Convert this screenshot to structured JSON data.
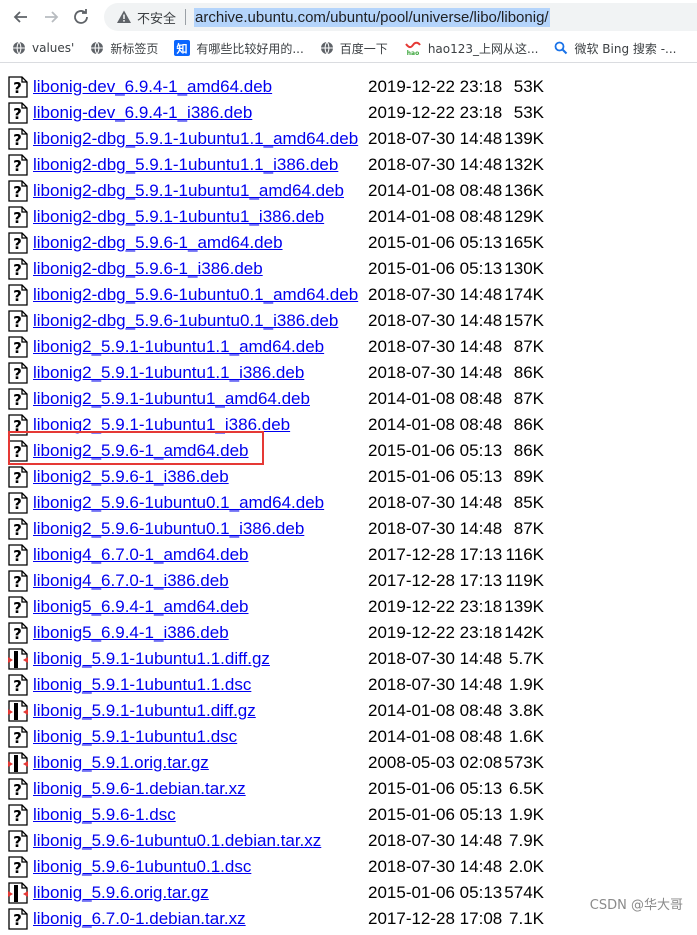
{
  "browser": {
    "security_label": "不安全",
    "url": "archive.ubuntu.com/ubuntu/pool/universe/libo/libonig/"
  },
  "bookmarks": [
    {
      "label": "values'",
      "icon": "globe-icon"
    },
    {
      "label": "新标签页",
      "icon": "globe-icon"
    },
    {
      "label": "有哪些比较好用的...",
      "icon": "zhihu-icon"
    },
    {
      "label": "百度一下",
      "icon": "globe-icon"
    },
    {
      "label": "hao123_上网从这...",
      "icon": "hao123-icon"
    },
    {
      "label": "微软 Bing 搜索 -...",
      "icon": "search-icon"
    }
  ],
  "files": [
    {
      "name": "libonig-dev_6.9.4-1_amd64.deb",
      "date": "2019-12-22 23:18",
      "size": "53K",
      "icon": "unknown-file-icon"
    },
    {
      "name": "libonig-dev_6.9.4-1_i386.deb",
      "date": "2019-12-22 23:18",
      "size": "53K",
      "icon": "unknown-file-icon"
    },
    {
      "name": "libonig2-dbg_5.9.1-1ubuntu1.1_amd64.deb",
      "date": "2018-07-30 14:48",
      "size": "139K",
      "icon": "unknown-file-icon"
    },
    {
      "name": "libonig2-dbg_5.9.1-1ubuntu1.1_i386.deb",
      "date": "2018-07-30 14:48",
      "size": "132K",
      "icon": "unknown-file-icon"
    },
    {
      "name": "libonig2-dbg_5.9.1-1ubuntu1_amd64.deb",
      "date": "2014-01-08 08:48",
      "size": "136K",
      "icon": "unknown-file-icon"
    },
    {
      "name": "libonig2-dbg_5.9.1-1ubuntu1_i386.deb",
      "date": "2014-01-08 08:48",
      "size": "129K",
      "icon": "unknown-file-icon"
    },
    {
      "name": "libonig2-dbg_5.9.6-1_amd64.deb",
      "date": "2015-01-06 05:13",
      "size": "165K",
      "icon": "unknown-file-icon"
    },
    {
      "name": "libonig2-dbg_5.9.6-1_i386.deb",
      "date": "2015-01-06 05:13",
      "size": "130K",
      "icon": "unknown-file-icon"
    },
    {
      "name": "libonig2-dbg_5.9.6-1ubuntu0.1_amd64.deb",
      "date": "2018-07-30 14:48",
      "size": "174K",
      "icon": "unknown-file-icon"
    },
    {
      "name": "libonig2-dbg_5.9.6-1ubuntu0.1_i386.deb",
      "date": "2018-07-30 14:48",
      "size": "157K",
      "icon": "unknown-file-icon"
    },
    {
      "name": "libonig2_5.9.1-1ubuntu1.1_amd64.deb",
      "date": "2018-07-30 14:48",
      "size": "87K",
      "icon": "unknown-file-icon"
    },
    {
      "name": "libonig2_5.9.1-1ubuntu1.1_i386.deb",
      "date": "2018-07-30 14:48",
      "size": "86K",
      "icon": "unknown-file-icon"
    },
    {
      "name": "libonig2_5.9.1-1ubuntu1_amd64.deb",
      "date": "2014-01-08 08:48",
      "size": "87K",
      "icon": "unknown-file-icon"
    },
    {
      "name": "libonig2_5.9.1-1ubuntu1_i386.deb",
      "date": "2014-01-08 08:48",
      "size": "86K",
      "icon": "unknown-file-icon"
    },
    {
      "name": "libonig2_5.9.6-1_amd64.deb",
      "date": "2015-01-06 05:13",
      "size": "86K",
      "icon": "unknown-file-icon"
    },
    {
      "name": "libonig2_5.9.6-1_i386.deb",
      "date": "2015-01-06 05:13",
      "size": "89K",
      "icon": "unknown-file-icon"
    },
    {
      "name": "libonig2_5.9.6-1ubuntu0.1_amd64.deb",
      "date": "2018-07-30 14:48",
      "size": "85K",
      "icon": "unknown-file-icon"
    },
    {
      "name": "libonig2_5.9.6-1ubuntu0.1_i386.deb",
      "date": "2018-07-30 14:48",
      "size": "87K",
      "icon": "unknown-file-icon"
    },
    {
      "name": "libonig4_6.7.0-1_amd64.deb",
      "date": "2017-12-28 17:13",
      "size": "116K",
      "icon": "unknown-file-icon"
    },
    {
      "name": "libonig4_6.7.0-1_i386.deb",
      "date": "2017-12-28 17:13",
      "size": "119K",
      "icon": "unknown-file-icon"
    },
    {
      "name": "libonig5_6.9.4-1_amd64.deb",
      "date": "2019-12-22 23:18",
      "size": "139K",
      "icon": "unknown-file-icon"
    },
    {
      "name": "libonig5_6.9.4-1_i386.deb",
      "date": "2019-12-22 23:18",
      "size": "142K",
      "icon": "unknown-file-icon"
    },
    {
      "name": "libonig_5.9.1-1ubuntu1.1.diff.gz",
      "date": "2018-07-30 14:48",
      "size": "5.7K",
      "icon": "compressed-file-icon"
    },
    {
      "name": "libonig_5.9.1-1ubuntu1.1.dsc",
      "date": "2018-07-30 14:48",
      "size": "1.9K",
      "icon": "unknown-file-icon"
    },
    {
      "name": "libonig_5.9.1-1ubuntu1.diff.gz",
      "date": "2014-01-08 08:48",
      "size": "3.8K",
      "icon": "compressed-file-icon"
    },
    {
      "name": "libonig_5.9.1-1ubuntu1.dsc",
      "date": "2014-01-08 08:48",
      "size": "1.6K",
      "icon": "unknown-file-icon"
    },
    {
      "name": "libonig_5.9.1.orig.tar.gz",
      "date": "2008-05-03 02:08",
      "size": "573K",
      "icon": "compressed-file-icon"
    },
    {
      "name": "libonig_5.9.6-1.debian.tar.xz",
      "date": "2015-01-06 05:13",
      "size": "6.5K",
      "icon": "unknown-file-icon"
    },
    {
      "name": "libonig_5.9.6-1.dsc",
      "date": "2015-01-06 05:13",
      "size": "1.9K",
      "icon": "unknown-file-icon"
    },
    {
      "name": "libonig_5.9.6-1ubuntu0.1.debian.tar.xz",
      "date": "2018-07-30 14:48",
      "size": "7.9K",
      "icon": "unknown-file-icon"
    },
    {
      "name": "libonig_5.9.6-1ubuntu0.1.dsc",
      "date": "2018-07-30 14:48",
      "size": "2.0K",
      "icon": "unknown-file-icon"
    },
    {
      "name": "libonig_5.9.6.orig.tar.gz",
      "date": "2015-01-06 05:13",
      "size": "574K",
      "icon": "compressed-file-icon"
    },
    {
      "name": "libonig_6.7.0-1.debian.tar.xz",
      "date": "2017-12-28 17:08",
      "size": "7.1K",
      "icon": "unknown-file-icon"
    }
  ],
  "highlighted_file": "libonig2_5.9.6-1_amd64.deb",
  "watermark": "CSDN @华大哥",
  "colors": {
    "link": "#0000ee",
    "highlight": "#e53935",
    "url_selection": "#b4d4fb"
  }
}
